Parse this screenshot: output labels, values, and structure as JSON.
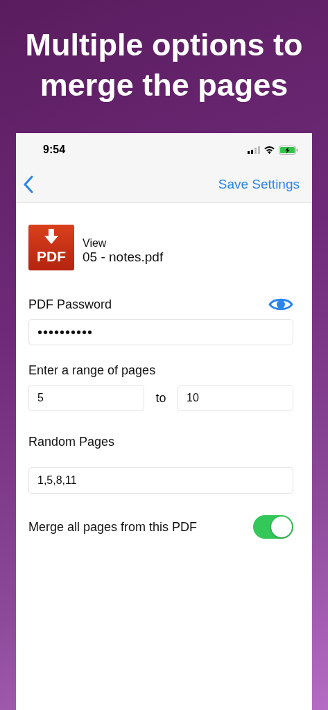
{
  "headline": "Multiple options to merge the pages",
  "status_bar": {
    "time": "9:54"
  },
  "nav_bar": {
    "action": "Save Settings"
  },
  "file": {
    "caption": "View",
    "name": "05 - notes.pdf",
    "icon_label": "PDF"
  },
  "password": {
    "label": "PDF Password",
    "value": "••••••••••"
  },
  "range": {
    "label": "Enter a range of pages",
    "from": "5",
    "separator": "to",
    "to": "10"
  },
  "random_pages": {
    "label": "Random Pages",
    "value": "1,5,8,11"
  },
  "merge_all": {
    "label": "Merge all pages from this PDF",
    "on": true
  }
}
